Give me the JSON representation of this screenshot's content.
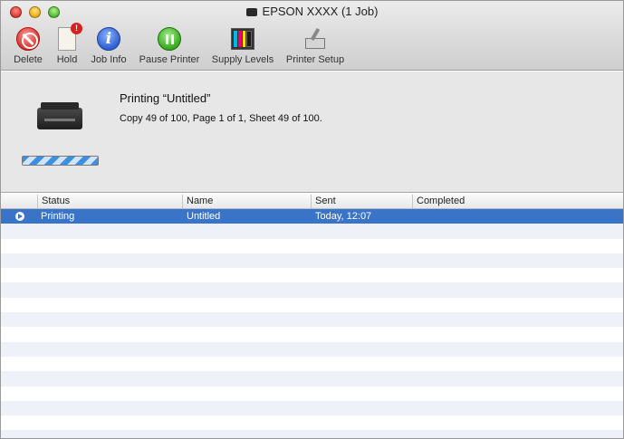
{
  "window": {
    "title": "EPSON XXXX (1 Job)"
  },
  "toolbar": {
    "items": [
      {
        "label": "Delete",
        "icon": "delete-icon"
      },
      {
        "label": "Hold",
        "icon": "hold-icon"
      },
      {
        "label": "Job Info",
        "icon": "info-icon"
      },
      {
        "label": "Pause Printer",
        "icon": "pause-icon"
      },
      {
        "label": "Supply Levels",
        "icon": "ink-cartridges-icon"
      },
      {
        "label": "Printer Setup",
        "icon": "printer-setup-icon"
      }
    ]
  },
  "status": {
    "title": "Printing “Untitled”",
    "detail": "Copy 49 of 100, Page 1 of 1, Sheet 49 of 100."
  },
  "table": {
    "headers": [
      "Status",
      "Name",
      "Sent",
      "Completed"
    ],
    "rows": [
      {
        "status": "Printing",
        "name": "Untitled",
        "sent": "Today, 12:07",
        "completed": ""
      }
    ]
  },
  "colors": {
    "selection": "#3a74c8",
    "ink": [
      "#00b7e8",
      "#e8007c",
      "#ffe100",
      "#1a1a1a"
    ]
  }
}
